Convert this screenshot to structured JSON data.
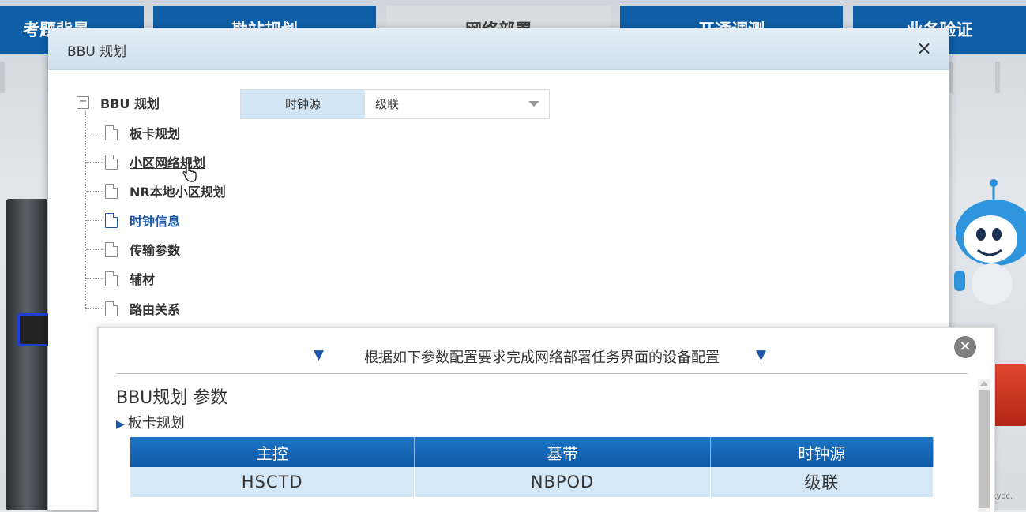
{
  "top_nav": {
    "tabs": [
      {
        "label": "考题背景",
        "active": false
      },
      {
        "label": "勘站规划",
        "active": false
      },
      {
        "label": "网络部署",
        "active": true
      },
      {
        "label": "开通调测",
        "active": false
      },
      {
        "label": "业务验证",
        "active": false
      }
    ]
  },
  "dialog": {
    "title": "BBU 规划",
    "close_symbol": "×"
  },
  "tree": {
    "root_label": "BBU 规划",
    "collapse_symbol": "−",
    "items": [
      {
        "label": "板卡规划"
      },
      {
        "label": "小区网络规划"
      },
      {
        "label": "NR本地小区规划"
      },
      {
        "label": "时钟信息"
      },
      {
        "label": "传输参数"
      },
      {
        "label": "辅材"
      },
      {
        "label": "路由关系"
      }
    ]
  },
  "clock_field": {
    "label": "时钟源",
    "value": "级联"
  },
  "requirements_panel": {
    "header": "根据如下参数配置要求完成网络部署任务界面的设备配置",
    "close_symbol": "✕",
    "section_title": "BBU规划 参数",
    "sub_section": "板卡规划",
    "table": {
      "headers": [
        "主控",
        "基带",
        "时钟源"
      ],
      "rows": [
        [
          "HSCTD",
          "NBPOD",
          "级联"
        ]
      ]
    }
  },
  "watermark": "CSDN @ukyoc.",
  "colors": {
    "nav_blue": "#0f5fa8",
    "tree_active": "#1a56a6",
    "table_header": "#0e5aa8",
    "table_cell": "#d5e8f7"
  }
}
